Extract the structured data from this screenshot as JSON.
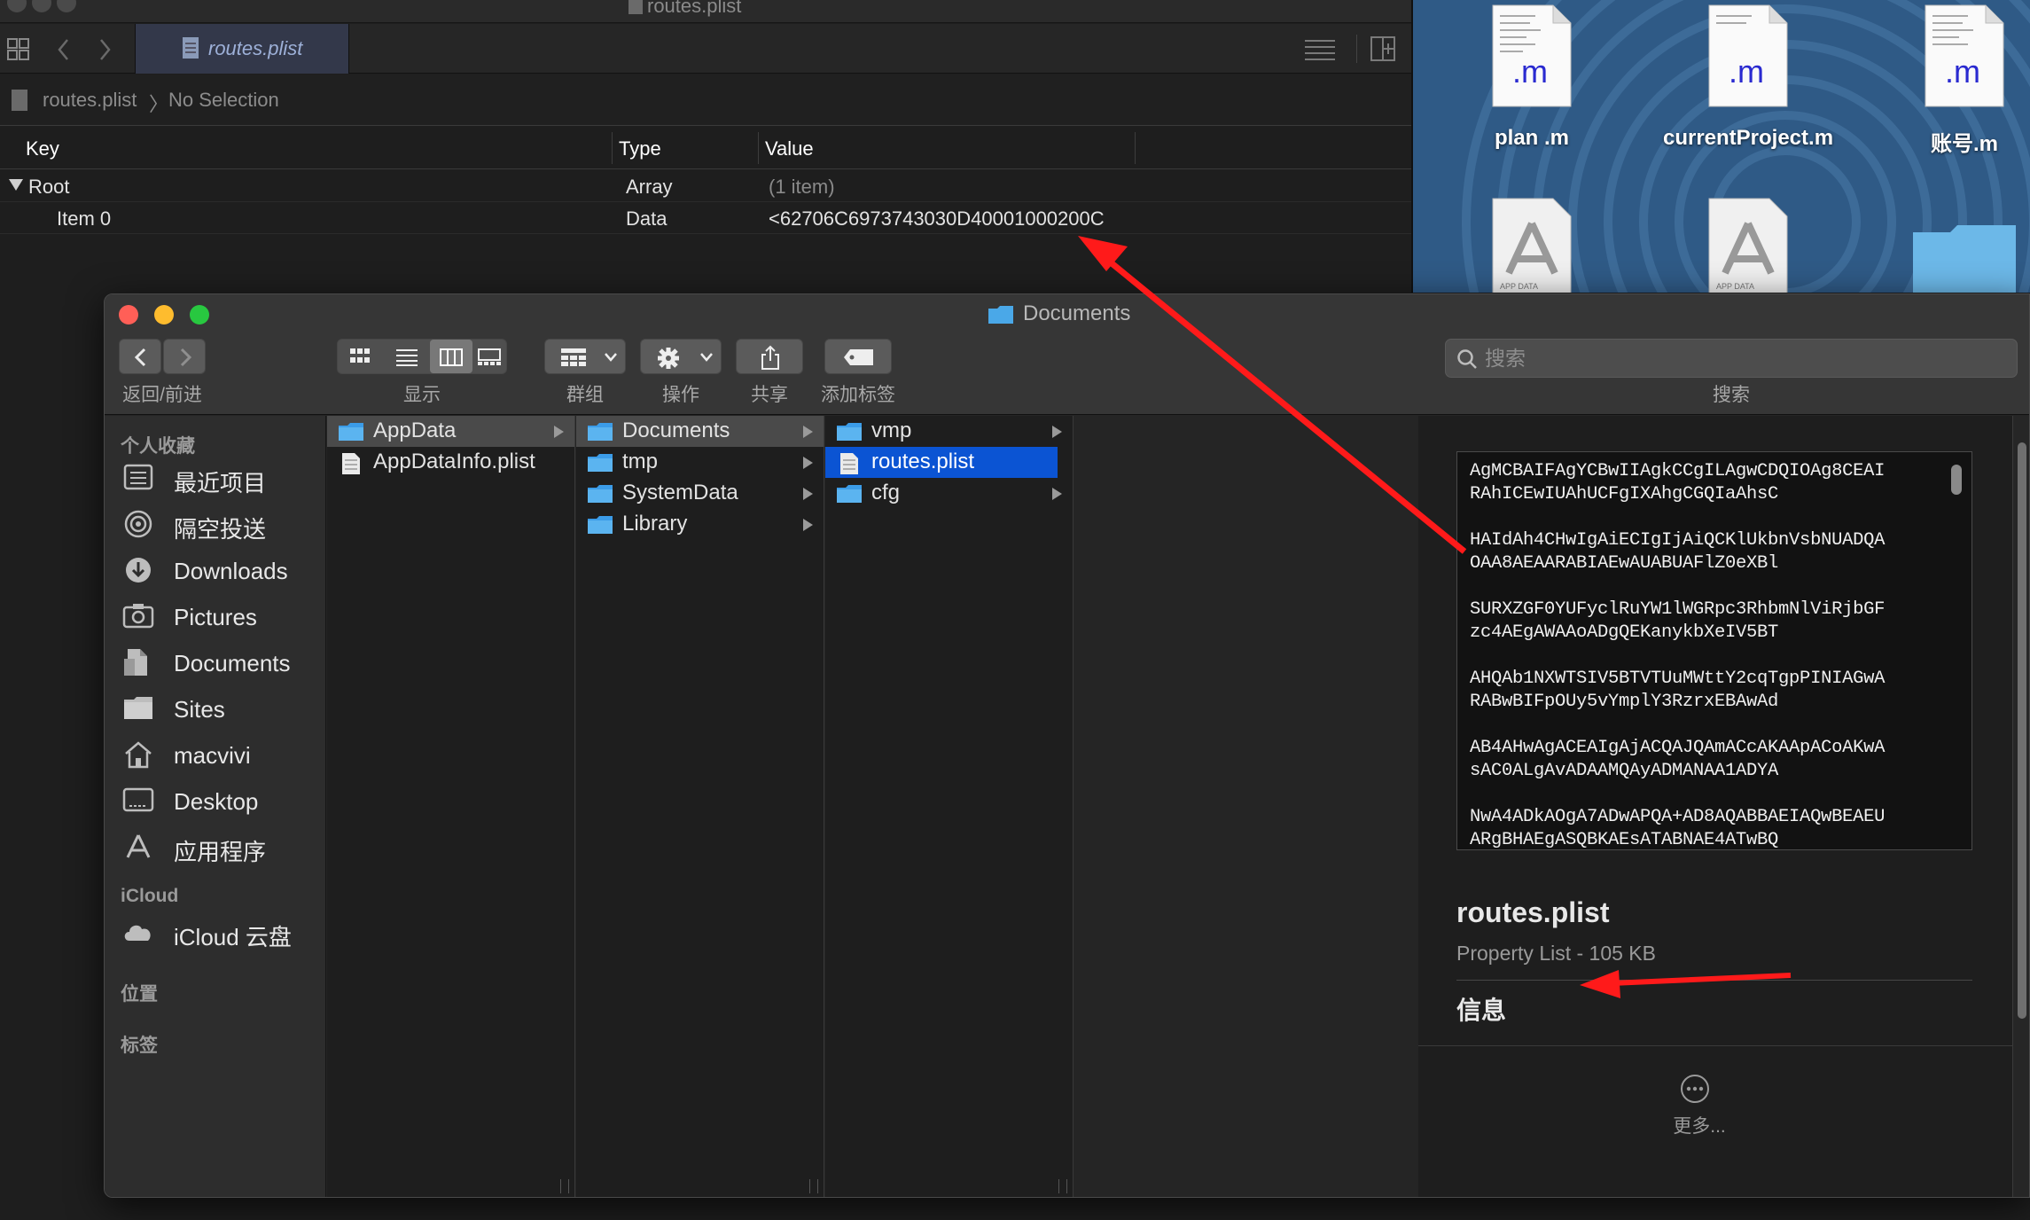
{
  "xcode": {
    "window_title": "routes.plist",
    "tab_label": "routes.plist",
    "jump_file": "routes.plist",
    "jump_sep": "〉",
    "jump_selection": "No Selection",
    "columns": {
      "key": "Key",
      "type": "Type",
      "value": "Value"
    },
    "rows": [
      {
        "key": "Root",
        "type": "Array",
        "value": "(1 item)"
      },
      {
        "key": "Item 0",
        "type": "Data",
        "value": "<62706C6973743030D40001000200C"
      }
    ]
  },
  "desktop": {
    "files": [
      {
        "label": "plan .m",
        "ext": ".m"
      },
      {
        "label": "currentProject.m",
        "ext": ".m"
      },
      {
        "label": "账号.m",
        "ext": ".m"
      }
    ],
    "app_badge_text": "APP DATA"
  },
  "finder": {
    "title": "Documents",
    "toolbar": {
      "nav_label": "返回/前进",
      "view_label": "显示",
      "group_label": "群组",
      "action_label": "操作",
      "share_label": "共享",
      "tag_label": "添加标签",
      "search_placeholder": "搜索",
      "search_label": "搜索"
    },
    "sidebar": {
      "favorites_heading": "个人收藏",
      "favorites": [
        {
          "label": "最近项目",
          "icon": "recents-icon"
        },
        {
          "label": "隔空投送",
          "icon": "airdrop-icon"
        },
        {
          "label": "Downloads",
          "icon": "downloads-icon"
        },
        {
          "label": "Pictures",
          "icon": "pictures-icon"
        },
        {
          "label": "Documents",
          "icon": "documents-icon"
        },
        {
          "label": "Sites",
          "icon": "folder-icon"
        },
        {
          "label": "macvivi",
          "icon": "home-icon"
        },
        {
          "label": "Desktop",
          "icon": "desktop-icon"
        },
        {
          "label": "应用程序",
          "icon": "applications-icon"
        }
      ],
      "icloud_heading": "iCloud",
      "icloud": [
        {
          "label": "iCloud 云盘",
          "icon": "cloud-icon"
        }
      ],
      "locations_heading": "位置",
      "tags_heading": "标签"
    },
    "columns": [
      [
        {
          "name": "AppData",
          "kind": "folder",
          "arrow": true
        },
        {
          "name": "AppDataInfo.plist",
          "kind": "file",
          "arrow": false
        }
      ],
      [
        {
          "name": "Documents",
          "kind": "folder",
          "arrow": true
        },
        {
          "name": "tmp",
          "kind": "folder",
          "arrow": true
        },
        {
          "name": "SystemData",
          "kind": "folder",
          "arrow": true
        },
        {
          "name": "Library",
          "kind": "folder",
          "arrow": true
        }
      ],
      [
        {
          "name": "vmp",
          "kind": "folder",
          "arrow": true
        },
        {
          "name": "routes.plist",
          "kind": "file",
          "arrow": false
        },
        {
          "name": "cfg",
          "kind": "folder",
          "arrow": true
        }
      ]
    ],
    "preview": {
      "lines": [
        "AgMCBAIFAgYCBwIIAgkCCgILAgwCDQIOAg8CEAI",
        "RAhICEwIUAhUCFgIXAhgCGQIaAhsC",
        "HAIdAh4CHwIgAiECIgIjAiQCKlUkbnVsbNUADQA",
        "OAA8AEAARABIAEwAUABUAFlZ0eXBl",
        "SURXZGF0YUFyclRuYW1lWGRpc3RhbmNlViRjbGF",
        "zc4AEgAWAAoADgQEKanykbXeIV5BT",
        "AHQAb1NXWTSIV5BTVTUuMWttY2cqTgpPINIAGwA",
        "RABwBIFpOUy5vYmplY3RzrxEBAwAd",
        "AB4AHwAgACEAIgAjACQAJQAmACcAKAApACoAKwA",
        "sAC0ALgAvADAAMQAyADMANAA1ADYA",
        "NwA4ADkAOgA7ADwAPQA+AD8AQABBAEIAQwBEAEU",
        "ARgBHAEgASQBKAEsATABNAE4ATwBQ"
      ],
      "file_name": "routes.plist",
      "file_kind": "Property List - 105 KB",
      "info_heading": "信息",
      "more_label": "更多..."
    }
  },
  "colors": {
    "selection_blue": "#0b54d3",
    "arrow_red": "#ff1a1a",
    "folder_blue": "#3b9ce8"
  }
}
